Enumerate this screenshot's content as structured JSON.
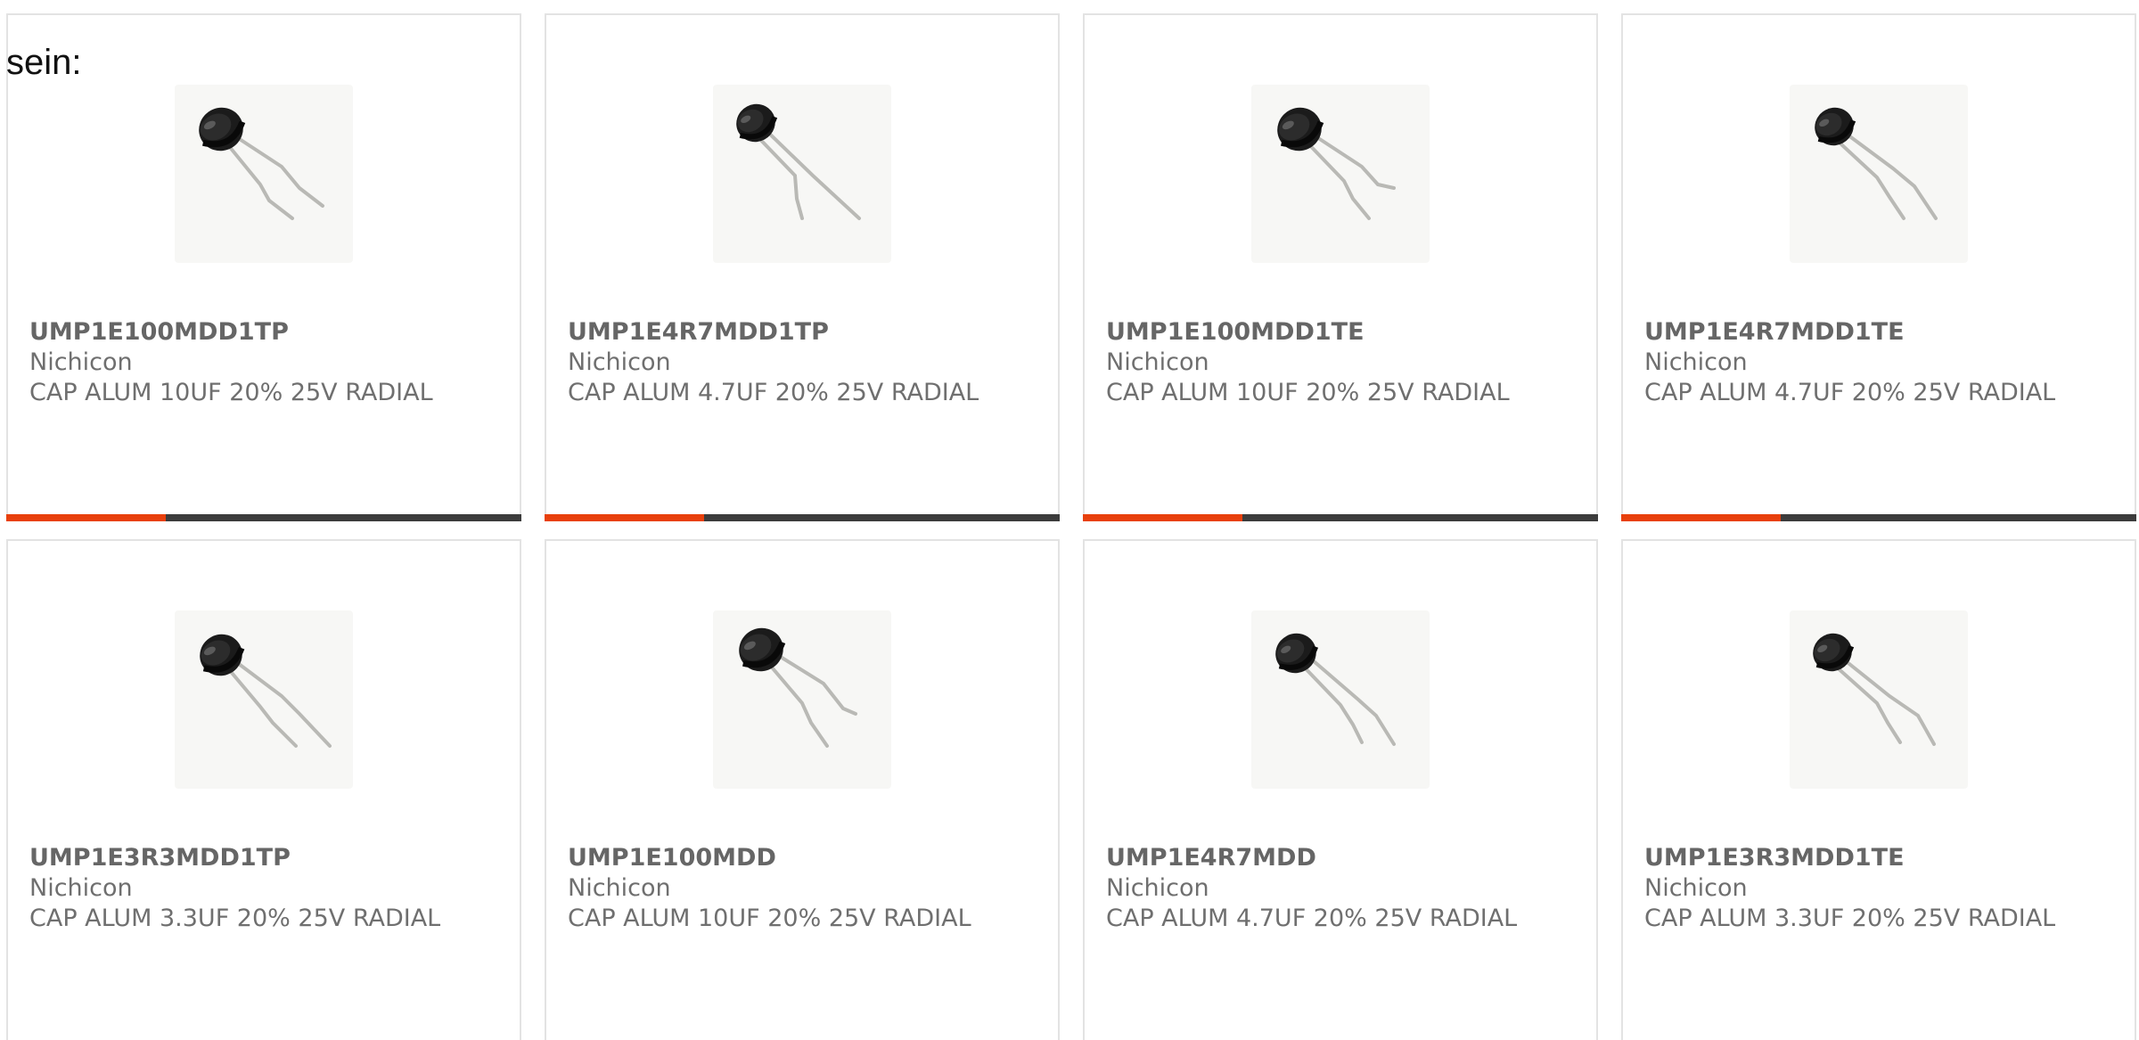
{
  "intro_text": "sein:",
  "colors": {
    "accent": "#e8400c",
    "bar_track": "#3c3c3c",
    "card_border": "#e3e3e3",
    "text": "#6f6f6f",
    "title": "#666666"
  },
  "product_image_icon": "electrolytic-capacitor-icon",
  "products": [
    {
      "part_number": "UMP1E100MDD1TP",
      "manufacturer": "Nichicon",
      "description": "CAP ALUM 10UF 20% 25V RADIAL",
      "progress_fraction": 0.31
    },
    {
      "part_number": "UMP1E4R7MDD1TP",
      "manufacturer": "Nichicon",
      "description": "CAP ALUM 4.7UF 20% 25V RADIAL",
      "progress_fraction": 0.31
    },
    {
      "part_number": "UMP1E100MDD1TE",
      "manufacturer": "Nichicon",
      "description": "CAP ALUM 10UF 20% 25V RADIAL",
      "progress_fraction": 0.31
    },
    {
      "part_number": "UMP1E4R7MDD1TE",
      "manufacturer": "Nichicon",
      "description": "CAP ALUM 4.7UF 20% 25V RADIAL",
      "progress_fraction": 0.31
    },
    {
      "part_number": "UMP1E3R3MDD1TP",
      "manufacturer": "Nichicon",
      "description": "CAP ALUM 3.3UF 20% 25V RADIAL"
    },
    {
      "part_number": "UMP1E100MDD",
      "manufacturer": "Nichicon",
      "description": "CAP ALUM 10UF 20% 25V RADIAL"
    },
    {
      "part_number": "UMP1E4R7MDD",
      "manufacturer": "Nichicon",
      "description": "CAP ALUM 4.7UF 20% 25V RADIAL"
    },
    {
      "part_number": "UMP1E3R3MDD1TE",
      "manufacturer": "Nichicon",
      "description": "CAP ALUM 3.3UF 20% 25V RADIAL"
    }
  ]
}
